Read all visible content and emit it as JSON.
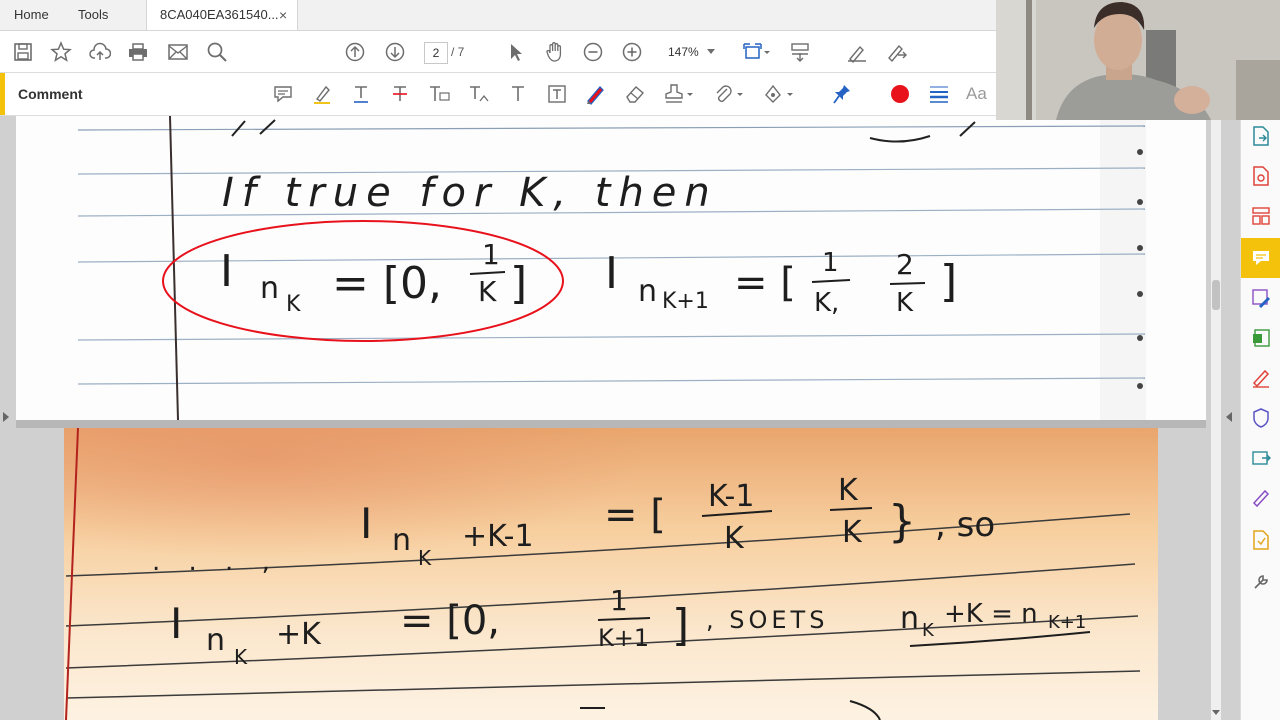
{
  "tabs": {
    "home": "Home",
    "tools": "Tools",
    "document": "8CA040EA361540...",
    "close_symbol": "×"
  },
  "toolbar": {
    "page_current": "2",
    "page_total": "/ 7",
    "zoom": "147%"
  },
  "comment_bar": {
    "label": "Comment",
    "text_size_label": "Aa"
  },
  "colors": {
    "accent_yellow": "#f4c10b",
    "record_red": "#e8121c",
    "blue_icon": "#2463c4"
  },
  "notes_page1": {
    "line1": "If true for K, then",
    "eq_left": "I",
    "eq_left_sub": "n",
    "eq_left_subsub": "K",
    "eq_rhs": "= [0,",
    "frac1_num": "1",
    "frac1_den": "K",
    "bracket_close": "]",
    "eq2_left": "I",
    "eq2_sub": "n",
    "eq2_subsub": "K+1",
    "eq2_rhs": "= [",
    "frac2_num": "1",
    "frac2_den": "K,",
    "frac3_num": "2",
    "frac3_den": "K"
  },
  "notes_page2": {
    "dots": ". . . ,",
    "l1_I": "I",
    "l1_sub": "n",
    "l1_subsub": "K",
    "l1_plus": "+K-1",
    "l1_eq": "= [",
    "l1_f1_num": "K-1",
    "l1_f1_den": "K",
    "l1_f2_num": "K",
    "l1_f2_den": "K",
    "l1_close": "}",
    "l1_so": ", so",
    "l2_I": "I",
    "l2_sub": "n",
    "l2_subsub": "K",
    "l2_plus": "+K",
    "l2_eq": "= [0,",
    "l2_f_num": "1",
    "l2_f_den": "K+1",
    "l2_close": "]",
    "l2_sets": ", SOETS",
    "l2_n": "n",
    "l2_nsub": "K",
    "l2_plusK": "+K = n",
    "l2_nsub2": "K+1"
  }
}
